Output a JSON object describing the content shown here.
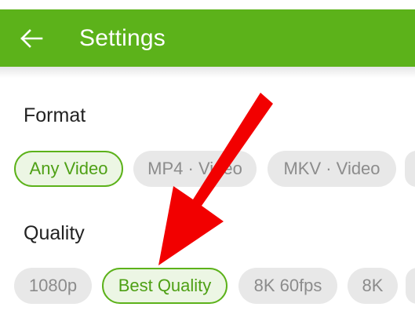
{
  "header": {
    "title": "Settings",
    "back_icon": "arrow-left-icon",
    "color": "#5cb21a"
  },
  "sections": [
    {
      "label": "Format",
      "chips": [
        {
          "label": "Any Video",
          "selected": true
        },
        {
          "label": "MP4 · Video",
          "selected": false
        },
        {
          "label": "MKV · Video",
          "selected": false
        },
        {
          "label": "",
          "selected": false
        }
      ]
    },
    {
      "label": "Quality",
      "chips": [
        {
          "label": "1080p",
          "selected": false
        },
        {
          "label": "Best Quality",
          "selected": true
        },
        {
          "label": "8K 60fps",
          "selected": false
        },
        {
          "label": "8K",
          "selected": false
        },
        {
          "label": "",
          "selected": false
        }
      ]
    }
  ],
  "annotation": {
    "type": "red-arrow",
    "color": "#f20000",
    "target": "Best Quality"
  },
  "colors": {
    "accent": "#5cb21a",
    "chip_selected_bg": "#ecf6e4",
    "chip_unselected_bg": "#e8e8e8",
    "chip_unselected_text": "#8c8c8c"
  }
}
